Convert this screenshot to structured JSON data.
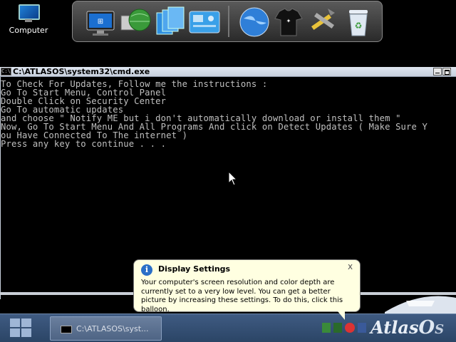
{
  "desktop": {
    "icons": [
      {
        "label": "Computer",
        "icon": "computer-icon"
      }
    ]
  },
  "dock": {
    "items": [
      {
        "name": "computer-monitor-icon"
      },
      {
        "name": "network-globe-icon"
      },
      {
        "name": "documents-icon"
      },
      {
        "name": "control-panel-icon"
      },
      {
        "name": "internet-browser-icon"
      },
      {
        "name": "user-shirt-icon"
      },
      {
        "name": "tools-icon"
      },
      {
        "name": "recycle-bin-icon"
      }
    ]
  },
  "console": {
    "title": "C:\\ATLASOS\\system32\\cmd.exe",
    "icon_label": "C:\\",
    "lines": [
      "To Check For Updates, Follow me the instructions :",
      "Go To Start Menu, Control Panel",
      "Double Click on Security Center",
      "Go To automatic updates",
      "and choose \" Notify ME but i don't automatically download or install them \"",
      "Now, Go To Start Menu And All Programs And click on Detect Updates ( Make Sure Y",
      "ou Have Connected To The internet )",
      "Press any key to continue . . ."
    ]
  },
  "balloon": {
    "title": "Display Settings",
    "close": "x",
    "info_glyph": "i",
    "body": "Your computer's screen resolution and color depth are currently set to a very low level. You can get a better picture by increasing these settings. To do this, click this balloon."
  },
  "taskbar": {
    "task_label": "C:\\ATLASOS\\syst...",
    "brand_main": "Atlas",
    "brand_o": "O",
    "brand_s": "S"
  },
  "colors": {
    "console_text": "#c0c0c0",
    "taskbar": "#2b4566",
    "balloon": "#ffffe1"
  }
}
